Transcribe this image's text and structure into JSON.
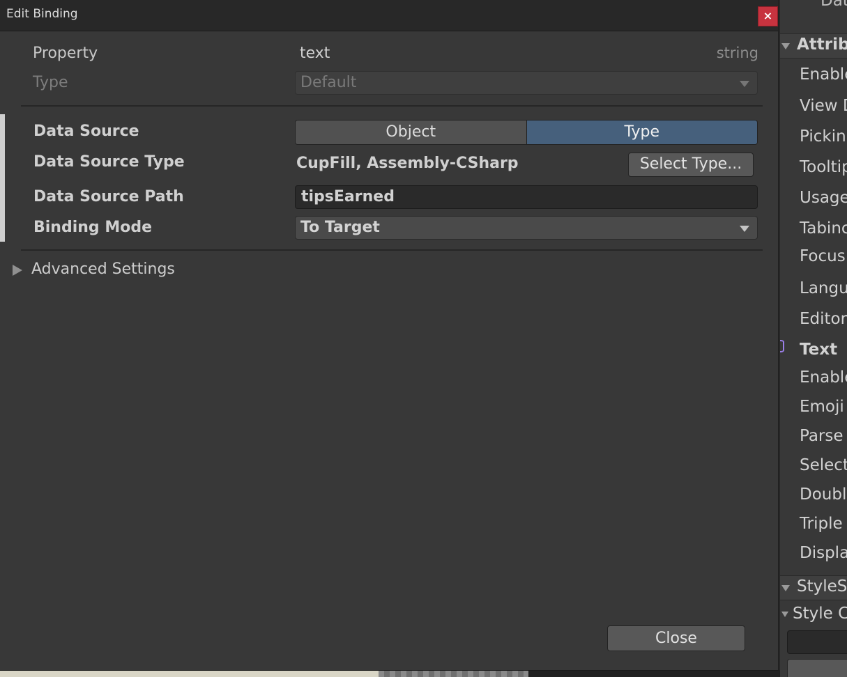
{
  "dialog": {
    "title": "Edit Binding",
    "close_glyph": "×",
    "close_label": "Close"
  },
  "property": {
    "label": "Property",
    "value": "text",
    "type_hint": "string"
  },
  "type_row": {
    "label": "Type",
    "value": "Default"
  },
  "data_source": {
    "label": "Data Source",
    "options": [
      "Object",
      "Type"
    ],
    "selected": "Type"
  },
  "data_source_type": {
    "label": "Data Source Type",
    "value": "CupFill, Assembly-CSharp",
    "button_label": "Select Type..."
  },
  "data_source_path": {
    "label": "Data Source Path",
    "value": "tipsEarned"
  },
  "binding_mode": {
    "label": "Binding Mode",
    "value": "To Target"
  },
  "advanced": {
    "label": "Advanced Settings"
  },
  "inspector": {
    "top_partial": "Dat",
    "attributes_header": "Attribu",
    "items": [
      "Enable",
      "View D",
      "Pickin",
      "Tooltip",
      "Usage",
      "Tabinc",
      "Focus",
      "Langu",
      "Editor"
    ],
    "text_bound": "Text",
    "text_items": [
      "Enable",
      "Emoji",
      "Parse",
      "Select",
      "Double",
      "Triple",
      "Displa"
    ],
    "stylesheet_header": "StyleS",
    "style_class": "Style C"
  },
  "colors": {
    "close_red": "#c7333f",
    "segment_active": "#46607c",
    "bound_icon": "#9b7fe8"
  }
}
